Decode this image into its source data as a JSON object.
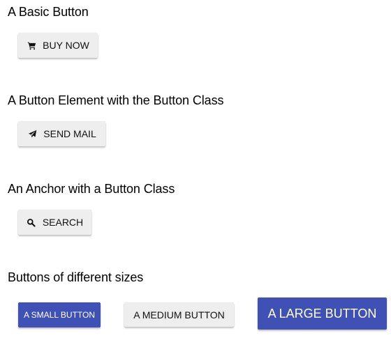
{
  "sections": {
    "basic": {
      "title": "A Basic Button",
      "button": {
        "label": "BUY NOW",
        "icon": "cart-icon"
      }
    },
    "element": {
      "title": "A Button Element with the Button Class",
      "button": {
        "label": "SEND MAIL",
        "icon": "paper-plane-icon"
      }
    },
    "anchor": {
      "title": "An Anchor with a Button Class",
      "button": {
        "label": "SEARCH",
        "icon": "search-icon"
      }
    },
    "sizes": {
      "title": "Buttons of different sizes",
      "small_label": "A SMALL BUTTON",
      "medium_label": "A MEDIUM BUTTON",
      "large_label": "A LARGE BUTTON"
    }
  },
  "colors": {
    "primary": "#3f51b5",
    "default_button_bg": "#eeeeee",
    "text": "#000000"
  }
}
